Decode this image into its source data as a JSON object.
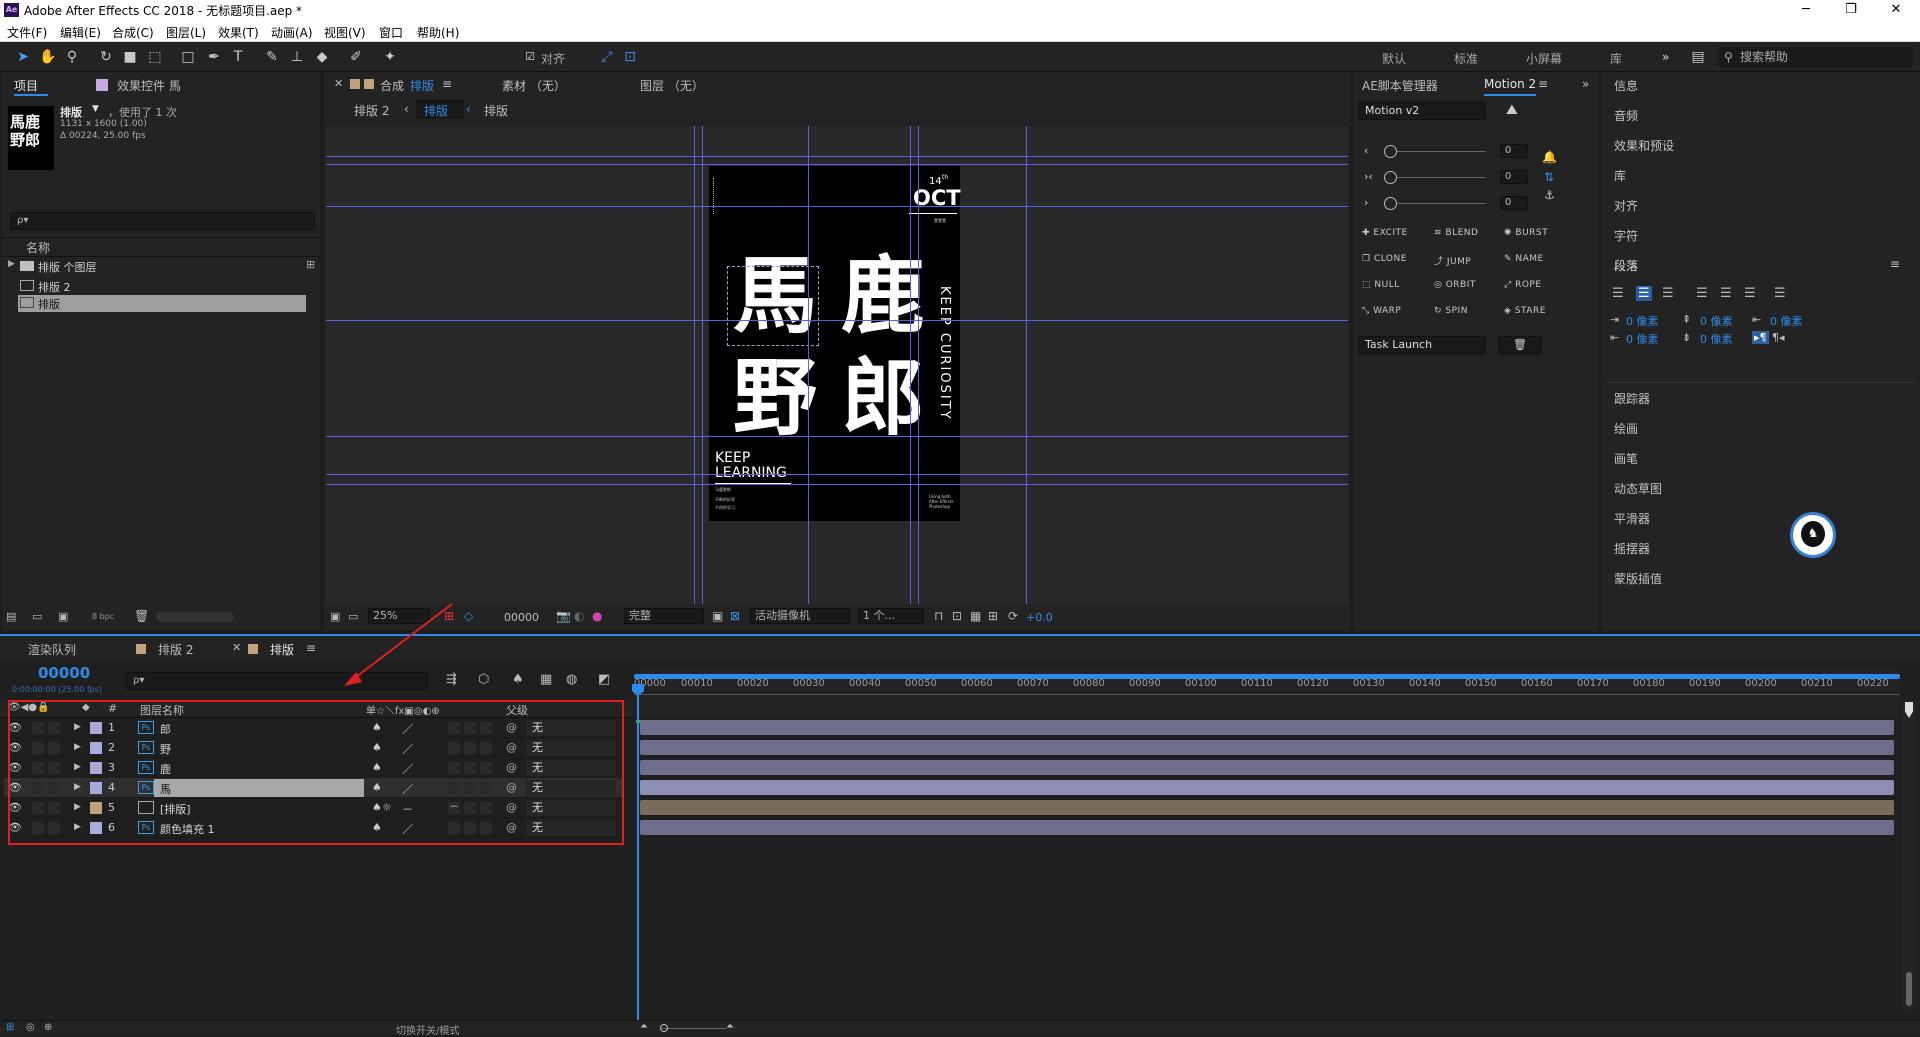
{
  "app": {
    "title": "Adobe After Effects CC 2018 - 无标题项目.aep *",
    "icon": "Ae"
  },
  "window_controls": {
    "minimize": "─",
    "maximize": "❐",
    "close": "✕"
  },
  "menu": [
    "文件(F)",
    "编辑(E)",
    "合成(C)",
    "图层(L)",
    "效果(T)",
    "动画(A)",
    "视图(V)",
    "窗口",
    "帮助(H)"
  ],
  "toolbar": {
    "align_label": "对齐",
    "workspaces": [
      "默认",
      "标准",
      "小屏幕",
      "库"
    ],
    "more": "»",
    "search_placeholder": "搜索帮助"
  },
  "project_panel": {
    "tab": "项目",
    "effects_tab": "效果控件 馬",
    "thumb_text": "馬鹿\n野郎",
    "item_name": "排版",
    "usage": "，使用了 1 次",
    "dims": "1131 x 1600 (1.00)",
    "duration": "Δ 00224, 25.00 fps",
    "search_placeholder": "ρ▾",
    "col_name": "名称",
    "items": [
      {
        "name": "排版 个图层",
        "type": "folder"
      },
      {
        "name": "排版 2",
        "type": "comp"
      },
      {
        "name": "排版",
        "type": "comp",
        "selected": true
      }
    ],
    "bpc": "8 bpc"
  },
  "viewer": {
    "tab_prefix": "合成",
    "tab_name": "排版",
    "footage_tab": "素材 （无）",
    "layer_tab": "图层 （无）",
    "breadcrumbs": [
      "排版 2",
      "排版",
      "排版"
    ],
    "zoom": "25%",
    "timecode": "00000",
    "resolution": "完整",
    "camera": "活动摄像机",
    "views": "1 个...",
    "exposure": "+0.0"
  },
  "poster": {
    "day": "14",
    "day_sup": "th",
    "month": "OCT",
    "small_top": "壹零壹",
    "chars": [
      "馬",
      "鹿",
      "野",
      "郎"
    ],
    "vertical": "KEEP CURIOSITY",
    "bottom1": "KEEP",
    "bottom2": "LEARNING",
    "cn1": "马鹿野郎",
    "cn2": "不断的好奇",
    "cn3": "不停的学习",
    "right_small": "Using both After Effects Photoshop"
  },
  "motion": {
    "tab1": "AE脚本管理器",
    "tab2": "Motion 2",
    "version": "Motion v2",
    "slider_vals": [
      "0",
      "0",
      "0"
    ],
    "buttons": [
      "EXCITE",
      "BLEND",
      "BURST",
      "CLONE",
      "JUMP",
      "NAME",
      "NULL",
      "ORBIT",
      "ROPE",
      "WARP",
      "SPIN",
      "STARE"
    ],
    "task": "Task Launch"
  },
  "right_panel": {
    "items_top": [
      "信息",
      "音频",
      "效果和预设",
      "库",
      "对齐",
      "字符"
    ],
    "paragraph": "段落",
    "indent": [
      "0 像素",
      "0 像素",
      "0 像素",
      "0 像素",
      "0 像素"
    ],
    "items_bottom": [
      "跟踪器",
      "绘画",
      "画笔",
      "动态草图",
      "平滑器",
      "摇摆器",
      "蒙版插值"
    ]
  },
  "timeline": {
    "tabs": [
      "渲染队列",
      "排版 2",
      "排版"
    ],
    "timecode": "00000",
    "timecode_sub": "0:00:00:00 (25.00 fps)",
    "search_placeholder": "ρ▾",
    "col_hash": "#",
    "col_name": "图层名称",
    "col_switches": "单☆＼fx▣◎◐⊕",
    "col_parent": "父级",
    "ticks": [
      "00000",
      "00010",
      "00020",
      "00030",
      "00040",
      "00050",
      "00060",
      "00070",
      "00080",
      "00090",
      "00100",
      "00110",
      "00120",
      "00130",
      "00140",
      "00150",
      "00160",
      "00170",
      "00180",
      "00190",
      "00200",
      "00210",
      "00220"
    ],
    "footer": "切换开关/模式",
    "layers": [
      {
        "num": "1",
        "name": "郎",
        "type": "Ps",
        "parent": "无",
        "color": "#a9a9e0",
        "bar": "#6e6e8c"
      },
      {
        "num": "2",
        "name": "野",
        "type": "Ps",
        "parent": "无",
        "color": "#a9a9e0",
        "bar": "#6e6e8c"
      },
      {
        "num": "3",
        "name": "鹿",
        "type": "Ps",
        "parent": "无",
        "color": "#a9a9e0",
        "bar": "#6e6e8c"
      },
      {
        "num": "4",
        "name": "馬",
        "type": "Ps",
        "parent": "无",
        "color": "#a9a9e0",
        "bar": "#8e8eb4",
        "selected": true
      },
      {
        "num": "5",
        "name": "[排版]",
        "type": "comp",
        "parent": "无",
        "color": "#c2a27b",
        "bar": "#7a6c5a"
      },
      {
        "num": "6",
        "name": "颜色填充 1",
        "type": "Ps",
        "parent": "无",
        "color": "#a9a9e0",
        "bar": "#6e6e8c"
      }
    ]
  },
  "colors": {
    "accent": "#2d8ceb",
    "guide": "#5d5ee0",
    "annotation": "#e02020"
  }
}
